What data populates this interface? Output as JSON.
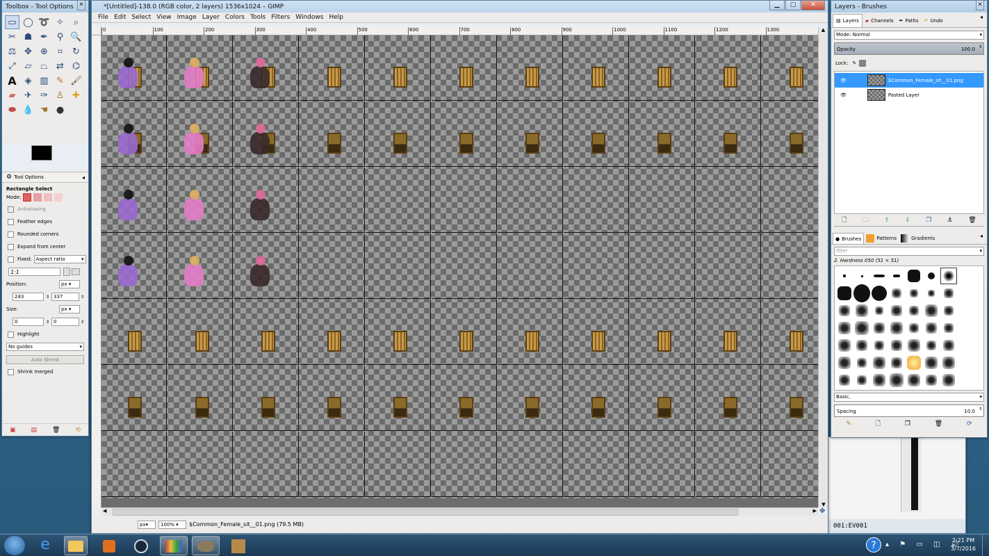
{
  "toolbox": {
    "title": "Toolbox - Tool Options",
    "tool_options_tab": "Tool Options",
    "tool_name": "Rectangle Select",
    "mode_label": "Mode:",
    "antialiasing": "Antialiasing",
    "feather_edges": "Feather edges",
    "rounded_corners": "Rounded corners",
    "expand_from_center": "Expand from center",
    "fixed_label": "Fixed:",
    "fixed_value": "Aspect ratio",
    "ratio_value": "1:1",
    "position_label": "Position:",
    "position_unit": "px",
    "position_x": "243",
    "position_y": "337",
    "size_label": "Size:",
    "size_unit": "px",
    "size_w": "0",
    "size_h": "0",
    "highlight": "Highlight",
    "guides_value": "No guides",
    "auto_shrink": "Auto Shrink",
    "shrink_merged": "Shrink merged"
  },
  "gimp": {
    "title": "*[Untitled]-138.0 (RGB color, 2 layers) 1536x1024 – GIMP",
    "menus": [
      "File",
      "Edit",
      "Select",
      "View",
      "Image",
      "Layer",
      "Colors",
      "Tools",
      "Filters",
      "Windows",
      "Help"
    ],
    "ruler_ticks": [
      "0",
      "100",
      "200",
      "300",
      "400",
      "500",
      "600",
      "700",
      "800",
      "900",
      "1000",
      "1100",
      "1200",
      "1300"
    ],
    "status_unit": "px",
    "status_zoom": "100%",
    "status_text": "$Common_Female_sit__01.png (79.5 MB)"
  },
  "dock": {
    "title": "Layers - Brushes",
    "tabs": [
      "Layers",
      "Channels",
      "Paths",
      "Undo"
    ],
    "mode_label": "Mode: Normal",
    "opacity_label": "Opacity",
    "opacity_value": "100.0",
    "lock_label": "Lock:",
    "layers": [
      {
        "name": "$Common_Female_sit__01.png",
        "selected": true
      },
      {
        "name": "Pasted Layer",
        "selected": false
      }
    ],
    "brush_tabs": [
      "Brushes",
      "Patterns",
      "Gradients"
    ],
    "filter_placeholder": "filter",
    "brush_name": "2. Hardness 050 (51 × 51)",
    "brush_tag": "Basic,",
    "spacing_label": "Spacing",
    "spacing_value": "10.0"
  },
  "background_window": {
    "text": "001:EV001"
  },
  "taskbar": {
    "time": "2:21 PM",
    "date": "3/7/2016"
  },
  "colors": {
    "accent": "#3399ff",
    "taskbar": "#1f3f5c"
  }
}
